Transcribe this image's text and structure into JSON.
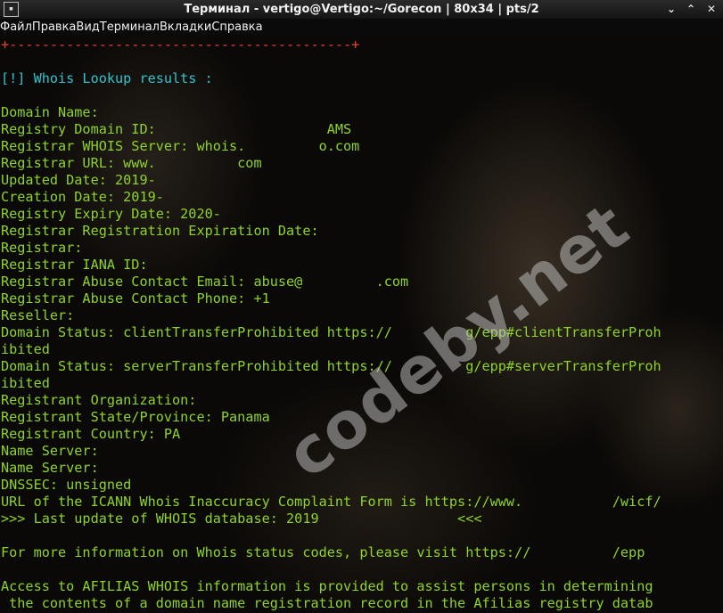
{
  "window": {
    "title": "Терминал - vertigo@Vertigo:~/Gorecon | 80x34 | pts/2",
    "icon_label": "▪",
    "controls": [
      "⌄",
      "⌃",
      "✕"
    ]
  },
  "menubar": {
    "items": [
      "Файл",
      "Правка",
      "Вид",
      "Терминал",
      "Вкладки",
      "Справка"
    ]
  },
  "terminal": {
    "lines": [
      {
        "text": "+------------------------------------------+",
        "color": "red"
      },
      {
        "text": "",
        "color": "green"
      },
      {
        "text": "[!] Whois Lookup results :",
        "color": "cyan"
      },
      {
        "text": "",
        "color": "green"
      },
      {
        "text": "Domain Name:",
        "color": "green"
      },
      {
        "text": "Registry Domain ID:                     AMS",
        "color": "green"
      },
      {
        "text": "Registrar WHOIS Server: whois.         o.com",
        "color": "green"
      },
      {
        "text": "Registrar URL: www.          com",
        "color": "green"
      },
      {
        "text": "Updated Date: 2019-",
        "color": "green"
      },
      {
        "text": "Creation Date: 2019-",
        "color": "green"
      },
      {
        "text": "Registry Expiry Date: 2020-",
        "color": "green"
      },
      {
        "text": "Registrar Registration Expiration Date:",
        "color": "green"
      },
      {
        "text": "Registrar:",
        "color": "green"
      },
      {
        "text": "Registrar IANA ID:",
        "color": "green"
      },
      {
        "text": "Registrar Abuse Contact Email: abuse@         .com",
        "color": "green"
      },
      {
        "text": "Registrar Abuse Contact Phone: +1",
        "color": "green"
      },
      {
        "text": "Reseller:",
        "color": "green"
      },
      {
        "text": "Domain Status: clientTransferProhibited https://         g/epp#clientTransferProh",
        "color": "green"
      },
      {
        "text": "ibited",
        "color": "green"
      },
      {
        "text": "Domain Status: serverTransferProhibited https://         g/epp#serverTransferProh",
        "color": "green"
      },
      {
        "text": "ibited",
        "color": "green"
      },
      {
        "text": "Registrant Organization:",
        "color": "green"
      },
      {
        "text": "Registrant State/Province: Panama",
        "color": "green"
      },
      {
        "text": "Registrant Country: PA",
        "color": "green"
      },
      {
        "text": "Name Server:",
        "color": "green"
      },
      {
        "text": "Name Server:",
        "color": "green"
      },
      {
        "text": "DNSSEC: unsigned",
        "color": "green"
      },
      {
        "text": "URL of the ICANN Whois Inaccuracy Complaint Form is https://www.           /wicf/",
        "color": "green"
      },
      {
        "text": ">>> Last update of WHOIS database: 2019                 <<<",
        "color": "green"
      },
      {
        "text": "",
        "color": "green"
      },
      {
        "text": "For more information on Whois status codes, please visit https://          /epp",
        "color": "green"
      },
      {
        "text": "",
        "color": "green"
      },
      {
        "text": "Access to AFILIAS WHOIS information is provided to assist persons in determining",
        "color": "green"
      },
      {
        "text": " the contents of a domain name registration record in the Afilias registry datab",
        "color": "green"
      }
    ]
  },
  "watermark": "codeby.net"
}
